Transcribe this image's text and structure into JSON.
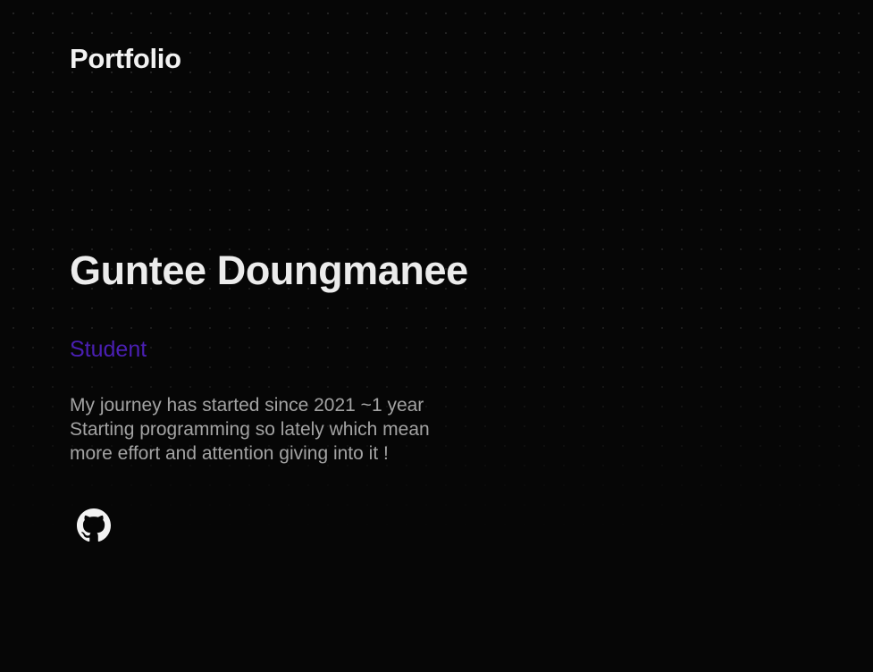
{
  "header": {
    "brand": "Portfolio"
  },
  "hero": {
    "name": "Guntee Doungmanee",
    "role": "Student",
    "bio_lines": [
      "My journey has started since 2021 ~1 year",
      "Starting programming so lately which mean",
      "more effort and attention giving into it !"
    ]
  },
  "social": {
    "github_icon": "github-icon"
  },
  "colors": {
    "background": "#060606",
    "heading": "#ececec",
    "accent": "#4a1fb3",
    "body_text": "#a3a3a3"
  }
}
